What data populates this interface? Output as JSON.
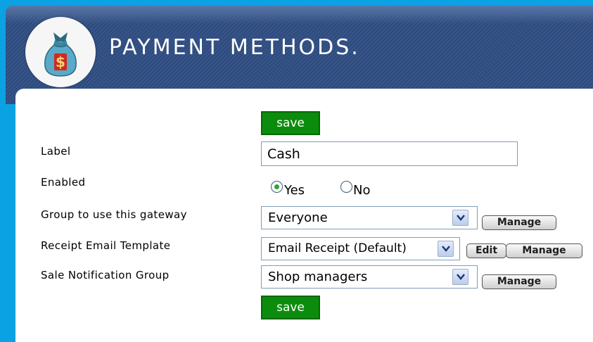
{
  "header": {
    "title": "PAYMENT METHODS.",
    "logo_icon": "money-bag-icon"
  },
  "form": {
    "save_label": "save",
    "label": {
      "label": "Label",
      "value": "Cash"
    },
    "enabled": {
      "label": "Enabled",
      "yes": "Yes",
      "no": "No",
      "selected": "Yes"
    },
    "group": {
      "label": "Group to use this gateway",
      "value": "Everyone",
      "manage": "Manage"
    },
    "receipt": {
      "label": "Receipt Email Template",
      "value": "Email Receipt (Default)",
      "edit": "Edit",
      "manage": "Manage"
    },
    "notification": {
      "label": "Sale Notification Group",
      "value": "Shop managers",
      "manage": "Manage"
    }
  },
  "colors": {
    "background": "#0aa2e3",
    "header": "#2f4b7c",
    "save_button": "#0c8c0c"
  }
}
